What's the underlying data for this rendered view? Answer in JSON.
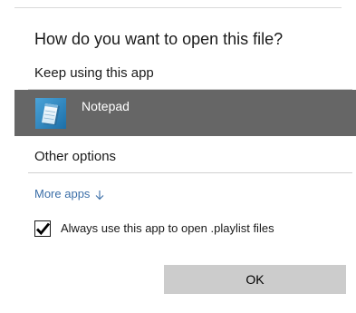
{
  "dialog": {
    "title": "How do you want to open this file?",
    "keep_using_label": "Keep using this app",
    "current_app": {
      "name": "Notepad",
      "icon": "notepad-icon",
      "selected": true
    },
    "other_options_label": "Other options",
    "more_apps": {
      "label": "More apps",
      "icon": "arrow-down-icon"
    },
    "always_use": {
      "label": "Always use this app to open .playlist files",
      "checked": true
    },
    "ok_label": "OK"
  },
  "colors": {
    "selected_row": "#666666",
    "link": "#3c6fa8",
    "button": "#cccccc",
    "rule": "#d0d0d0"
  }
}
